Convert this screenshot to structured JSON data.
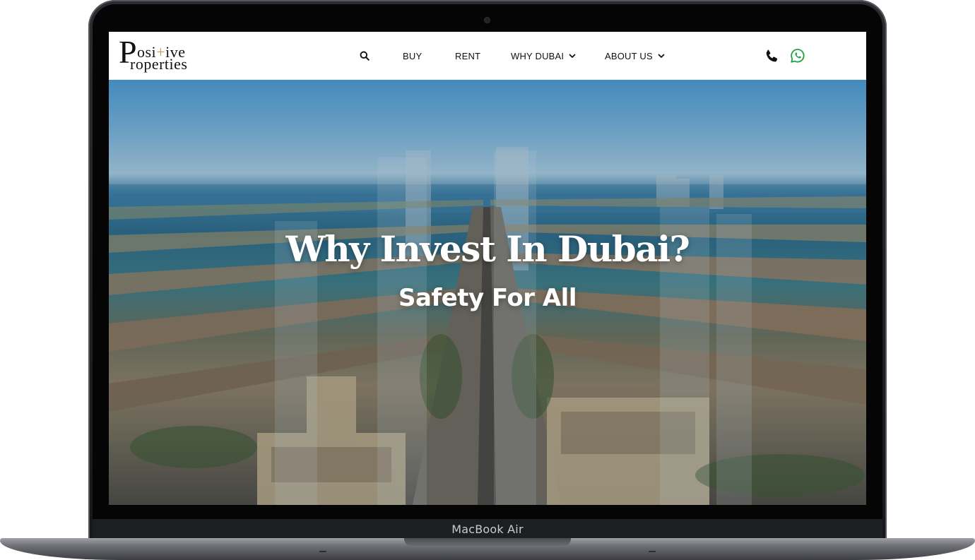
{
  "device": {
    "bezel_label": "MacBook Air"
  },
  "header": {
    "logo": {
      "big_letter": "P",
      "line1_a": "osi",
      "line1_plus": "+",
      "line1_b": "ive",
      "line2": "roperties",
      "plus_color": "#c49b4c"
    },
    "nav": {
      "search_icon": "search-icon",
      "items": [
        {
          "label": "BUY",
          "has_dropdown": false
        },
        {
          "label": "RENT",
          "has_dropdown": false
        },
        {
          "label": "WHY DUBAI",
          "has_dropdown": true
        },
        {
          "label": "ABOUT US",
          "has_dropdown": true
        }
      ]
    },
    "contact": {
      "phone_icon": "phone-icon",
      "whatsapp_icon": "whatsapp-icon",
      "whatsapp_color": "#25a244"
    }
  },
  "hero": {
    "title": "Why Invest In Dubai?",
    "subtitle": "Safety For All",
    "background": "aerial-view-palm-jumeirah"
  }
}
